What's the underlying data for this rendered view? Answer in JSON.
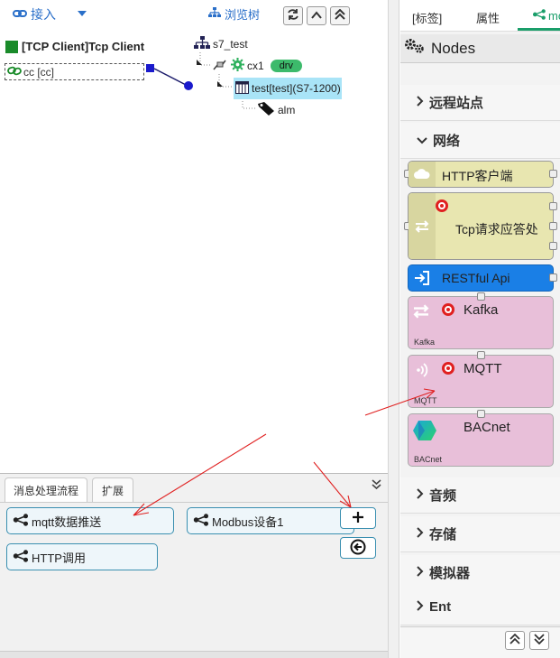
{
  "toolbar": {
    "connect_label": "接入",
    "browse_label": "浏览树"
  },
  "tcp_node": {
    "title": "[TCP Client]Tcp Client",
    "sub": "cc [cc]"
  },
  "tree": {
    "root": "s7_test",
    "conn": "cx1",
    "conn_badge": "drv",
    "device": "test[test](S7-1200)",
    "tag": "alm"
  },
  "bottom": {
    "tabs": [
      "消息处理流程",
      "扩展"
    ],
    "flows": [
      "mqtt数据推送",
      "Modbus设备1",
      "HTTP调用"
    ]
  },
  "right": {
    "tabs": [
      "[标签]",
      "属性",
      "mo"
    ],
    "nodes_title": "Nodes",
    "categories": {
      "remote": "远程站点",
      "network": "网络",
      "audio": "音频",
      "storage": "存储",
      "simulator": "模拟器",
      "ent": "Ent"
    },
    "nodes": {
      "http": "HTTP客户端",
      "tcp": "Tcp请求应答处",
      "rest": "RESTful Api",
      "kafka": "Kafka",
      "kafka_sub": "Kafka",
      "mqtt": "MQTT",
      "mqtt_sub": "MQTT",
      "bacnet": "BACnet",
      "bacnet_sub": "BACnet"
    }
  },
  "colors": {
    "accent": "#2a6fc9",
    "green": "#1a8b2a",
    "arrow": "#e02020",
    "pink_node": "#e8bfd9",
    "yellow_node": "#e8e6b0",
    "blue_node": "#1a7fe6"
  }
}
